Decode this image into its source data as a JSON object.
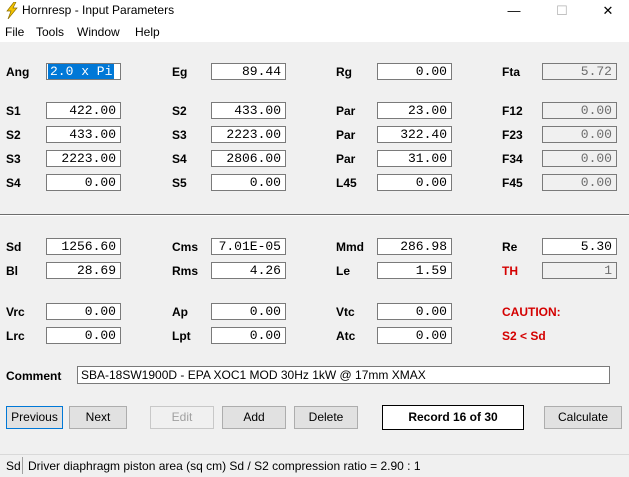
{
  "window": {
    "title": "Hornresp - Input Parameters",
    "minimize": "—",
    "maximize": "☐",
    "close": "✕"
  },
  "menu": [
    "File",
    "Tools",
    "Window",
    "Help"
  ],
  "params": {
    "ang": {
      "label": "Ang",
      "value": "2.0 x Pi"
    },
    "eg": {
      "label": "Eg",
      "value": "89.44"
    },
    "rg": {
      "label": "Rg",
      "value": "0.00"
    },
    "fta": {
      "label": "Fta",
      "value": "5.72"
    },
    "s1": {
      "label": "S1",
      "value": "422.00"
    },
    "s2": {
      "label": "S2",
      "value": "433.00"
    },
    "par1": {
      "label": "Par",
      "value": "23.00"
    },
    "f12": {
      "label": "F12",
      "value": "0.00"
    },
    "s2b": {
      "label": "S2",
      "value": "433.00"
    },
    "s3": {
      "label": "S3",
      "value": "2223.00"
    },
    "par2": {
      "label": "Par",
      "value": "322.40"
    },
    "f23": {
      "label": "F23",
      "value": "0.00"
    },
    "s3b": {
      "label": "S3",
      "value": "2223.00"
    },
    "s4": {
      "label": "S4",
      "value": "2806.00"
    },
    "par3": {
      "label": "Par",
      "value": "31.00"
    },
    "f34": {
      "label": "F34",
      "value": "0.00"
    },
    "s4b": {
      "label": "S4",
      "value": "0.00"
    },
    "s5": {
      "label": "S5",
      "value": "0.00"
    },
    "l45": {
      "label": "L45",
      "value": "0.00"
    },
    "f45": {
      "label": "F45",
      "value": "0.00"
    },
    "sd": {
      "label": "Sd",
      "value": "1256.60"
    },
    "cms": {
      "label": "Cms",
      "value": "7.01E-05"
    },
    "mmd": {
      "label": "Mmd",
      "value": "286.98"
    },
    "re": {
      "label": "Re",
      "value": "5.30"
    },
    "bl": {
      "label": "Bl",
      "value": "28.69"
    },
    "rms": {
      "label": "Rms",
      "value": "4.26"
    },
    "le": {
      "label": "Le",
      "value": "1.59"
    },
    "th": {
      "label": "TH",
      "value": "1"
    },
    "vrc": {
      "label": "Vrc",
      "value": "0.00"
    },
    "ap": {
      "label": "Ap",
      "value": "0.00"
    },
    "vtc": {
      "label": "Vtc",
      "value": "0.00"
    },
    "lrc": {
      "label": "Lrc",
      "value": "0.00"
    },
    "lpt": {
      "label": "Lpt",
      "value": "0.00"
    },
    "atc": {
      "label": "Atc",
      "value": "0.00"
    }
  },
  "caution": {
    "title": "CAUTION:",
    "message": "S2 < Sd"
  },
  "comment": {
    "label": "Comment",
    "value": "SBA-18SW1900D - EPA XOC1 MOD 30Hz 1kW @ 17mm XMAX"
  },
  "buttons": {
    "previous": "Previous",
    "next": "Next",
    "edit": "Edit",
    "add": "Add",
    "delete": "Delete",
    "record": "Record 16 of 30",
    "calculate": "Calculate"
  },
  "status": {
    "key": "Sd",
    "text": "Driver diaphragm piston area  (sq cm)   Sd / S2 compression ratio = 2.90 : 1"
  },
  "colors": {
    "accent": "#0078d7",
    "warning": "#d40000",
    "icon": "#f5c400"
  }
}
